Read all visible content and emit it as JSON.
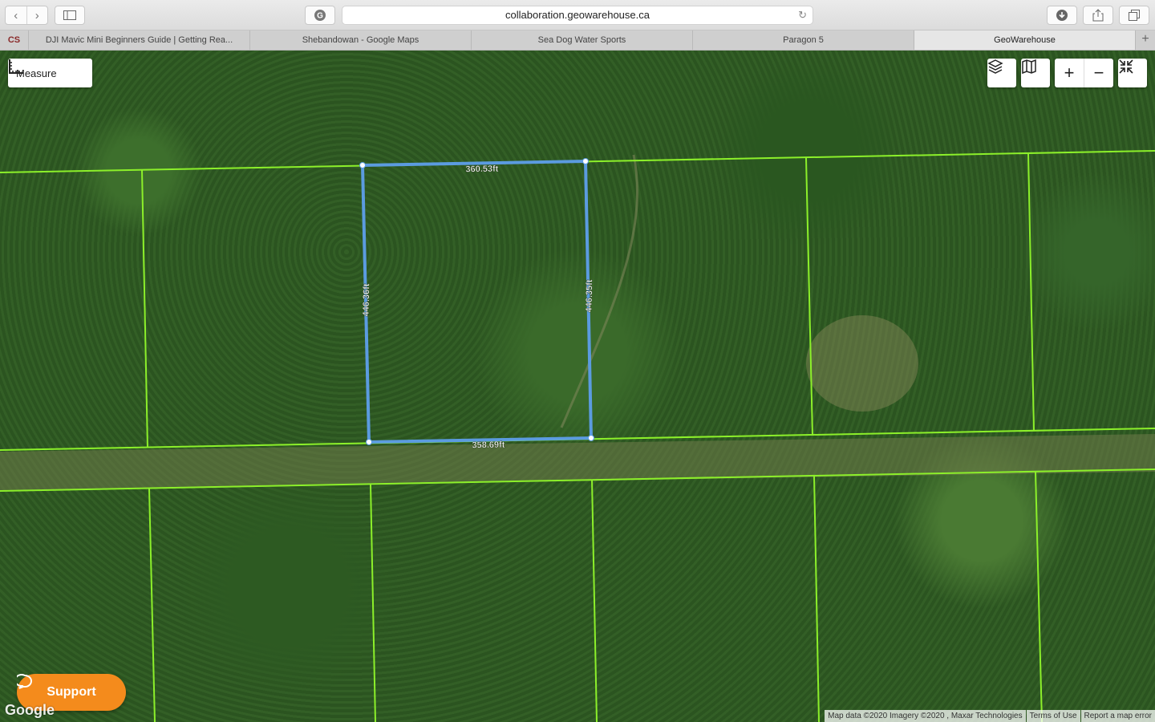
{
  "browser": {
    "url": "collaboration.geowarehouse.ca",
    "tabs": [
      {
        "label": "DJI Mavic Mini Beginners Guide | Getting Rea..."
      },
      {
        "label": "Shebandowan - Google Maps"
      },
      {
        "label": "Sea Dog Water Sports"
      },
      {
        "label": "Paragon 5"
      },
      {
        "label": "GeoWarehouse"
      }
    ],
    "favicon_text": "CS"
  },
  "map": {
    "measure_label": "Measure",
    "measurements": {
      "top": "360.53ft",
      "left": "446.36ft",
      "right": "446.35ft",
      "bottom": "358.69ft"
    },
    "support_label": "Support",
    "google_logo": "Google",
    "attribution": {
      "data": "Map data ©2020 Imagery ©2020 , Maxar Technologies",
      "terms": "Terms of Use",
      "report": "Report a map error"
    }
  },
  "colors": {
    "parcel_line": "#8cf02a",
    "measure_line": "#5b9be0",
    "support": "#f48b1c"
  }
}
